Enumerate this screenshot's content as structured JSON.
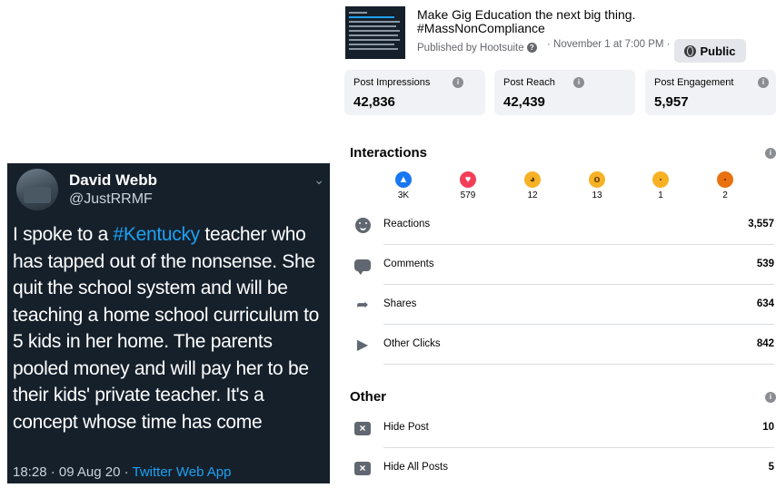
{
  "tweet": {
    "name": "David Webb",
    "handle": "@JustRRMF",
    "text_before": "I spoke to a ",
    "hashtag": "#Kentucky",
    "text_after": " teacher who has tapped out of the nonsense. She quit the school system and will be teaching a home school curriculum to 5 kids in her home. The parents pooled money and will pay her to be their kids' private teacher. It's a concept whose time has come",
    "time_date": "18:28 · 09 Aug 20 · ",
    "app": "Twitter Web App"
  },
  "post": {
    "title_line1": "Make Gig Education the next big thing.",
    "title_line2": "#MassNonCompliance",
    "published_by": "Published by Hootsuite",
    "date": "· November 1 at 7:00 PM ·",
    "privacy": "Public"
  },
  "metrics": [
    {
      "label": "Post Impressions",
      "value": "42,836"
    },
    {
      "label": "Post Reach",
      "value": "42,439"
    },
    {
      "label": "Post Engagement",
      "value": "5,957"
    }
  ],
  "interactions": {
    "title": "Interactions",
    "reactions_breakdown": [
      {
        "icon": "like-icon",
        "count": "3K",
        "color": "#1877f2"
      },
      {
        "icon": "love-icon",
        "count": "579",
        "color": "#f33e58"
      },
      {
        "icon": "haha-icon",
        "count": "12",
        "color": "#f7b125"
      },
      {
        "icon": "wow-icon",
        "count": "13",
        "color": "#f7b125"
      },
      {
        "icon": "sad-icon",
        "count": "1",
        "color": "#f7b125"
      },
      {
        "icon": "angry-icon",
        "count": "2",
        "color": "#e9710f"
      }
    ],
    "rows": [
      {
        "icon": "smiley-icon",
        "label": "Reactions",
        "value": "3,557"
      },
      {
        "icon": "comment-icon",
        "label": "Comments",
        "value": "539"
      },
      {
        "icon": "share-icon",
        "label": "Shares",
        "value": "634"
      },
      {
        "icon": "cursor-icon",
        "label": "Other Clicks",
        "value": "842"
      }
    ]
  },
  "other": {
    "title": "Other",
    "rows": [
      {
        "icon": "hide-post-icon",
        "label": "Hide Post",
        "value": "10"
      },
      {
        "icon": "hide-all-icon",
        "label": "Hide All Posts",
        "value": "5"
      }
    ]
  }
}
